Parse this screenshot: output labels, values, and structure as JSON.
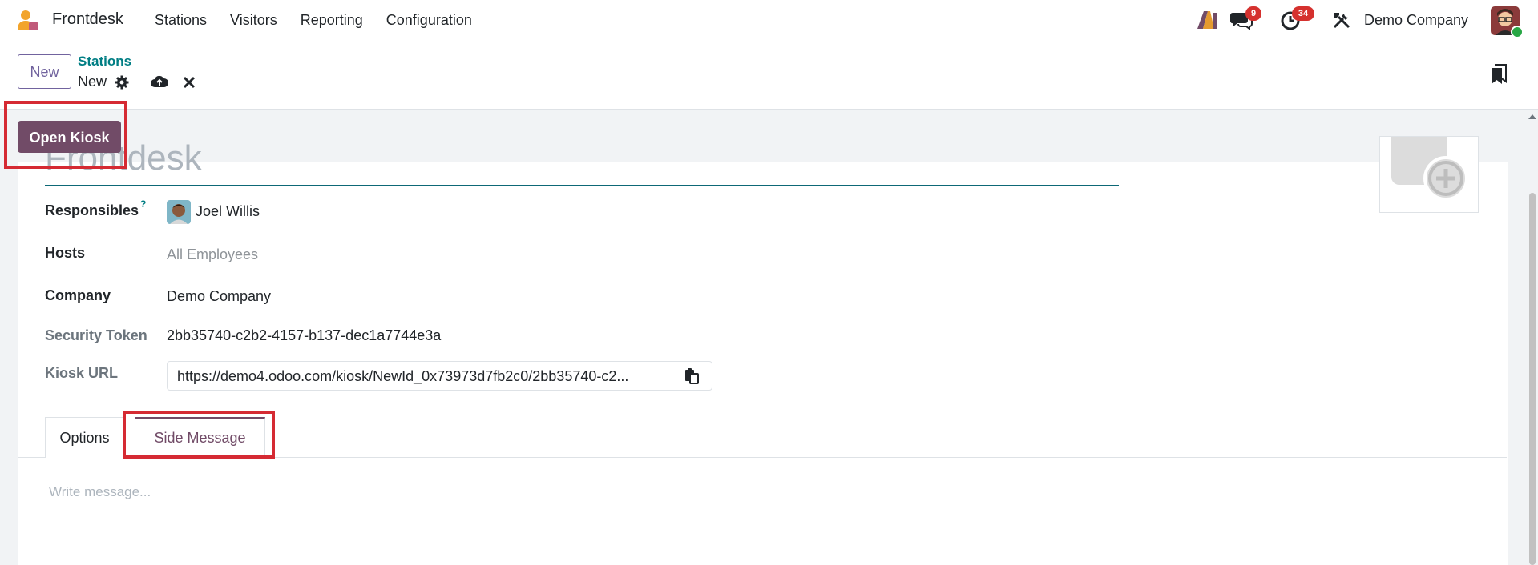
{
  "navbar": {
    "app_name": "Frontdesk",
    "menu": [
      "Stations",
      "Visitors",
      "Reporting",
      "Configuration"
    ],
    "chat_badge": "9",
    "activity_badge": "34",
    "company": "Demo Company",
    "brand_color": "#714b67"
  },
  "control_panel": {
    "new_label": "New",
    "breadcrumb_parent": "Stations",
    "breadcrumb_current": "New"
  },
  "statusbar": {
    "open_kiosk_label": "Open Kiosk"
  },
  "form": {
    "name_placeholder": "Frontdesk",
    "fields": {
      "responsibles_label": "Responsibles",
      "responsibles_help": "?",
      "responsibles_value": "Joel Willis",
      "hosts_label": "Hosts",
      "hosts_value": "All Employees",
      "company_label": "Company",
      "company_value": "Demo Company",
      "token_label": "Security Token",
      "token_value": "2bb35740-c2b2-4157-b137-dec1a7744e3a",
      "kiosk_url_label": "Kiosk URL",
      "kiosk_url_value": "https://demo4.odoo.com/kiosk/NewId_0x73973d7fb2c0/2bb35740-c2..."
    },
    "tabs": [
      "Options",
      "Side Message"
    ],
    "active_tab": "Side Message",
    "message_placeholder": "Write message..."
  },
  "icons": [
    "app-logo-icon",
    "ai-icon",
    "chat-icon",
    "activity-clock-icon",
    "tools-icon",
    "gear-icon",
    "cloud-upload-icon",
    "close-icon",
    "bookmark-icon",
    "copy-icon",
    "image-add-icon"
  ],
  "colors": {
    "accent": "#714b67",
    "link": "#017e84",
    "badge": "#d5312e",
    "highlight": "#d52a33"
  }
}
